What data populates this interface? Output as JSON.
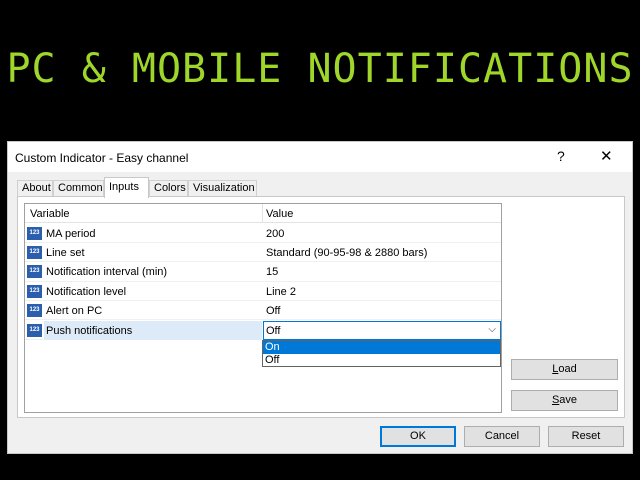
{
  "banner": "PC & MOBILE NOTIFICATIONS",
  "dialog": {
    "title": "Custom Indicator - Easy channel",
    "help_glyph": "?",
    "close_glyph": "✕"
  },
  "tabs": [
    "About",
    "Common",
    "Inputs",
    "Colors",
    "Visualization"
  ],
  "grid": {
    "col_variable": "Variable",
    "col_value": "Value",
    "icon_text": "123",
    "rows": [
      {
        "variable": "MA period",
        "value": "200"
      },
      {
        "variable": "Line set",
        "value": "Standard (90-95-98 & 2880 bars)"
      },
      {
        "variable": "Notification interval (min)",
        "value": "15"
      },
      {
        "variable": "Notification level",
        "value": "Line 2"
      },
      {
        "variable": "Alert on PC",
        "value": "Off"
      },
      {
        "variable": "Push notifications",
        "value": "Off"
      }
    ],
    "combo_arrow": "⌵"
  },
  "dropdown_options": [
    "On",
    "Off"
  ],
  "buttons": {
    "load_first": "L",
    "load_rest": "oad",
    "save_first": "S",
    "save_rest": "ave",
    "ok": "OK",
    "cancel": "Cancel",
    "reset": "Reset"
  }
}
